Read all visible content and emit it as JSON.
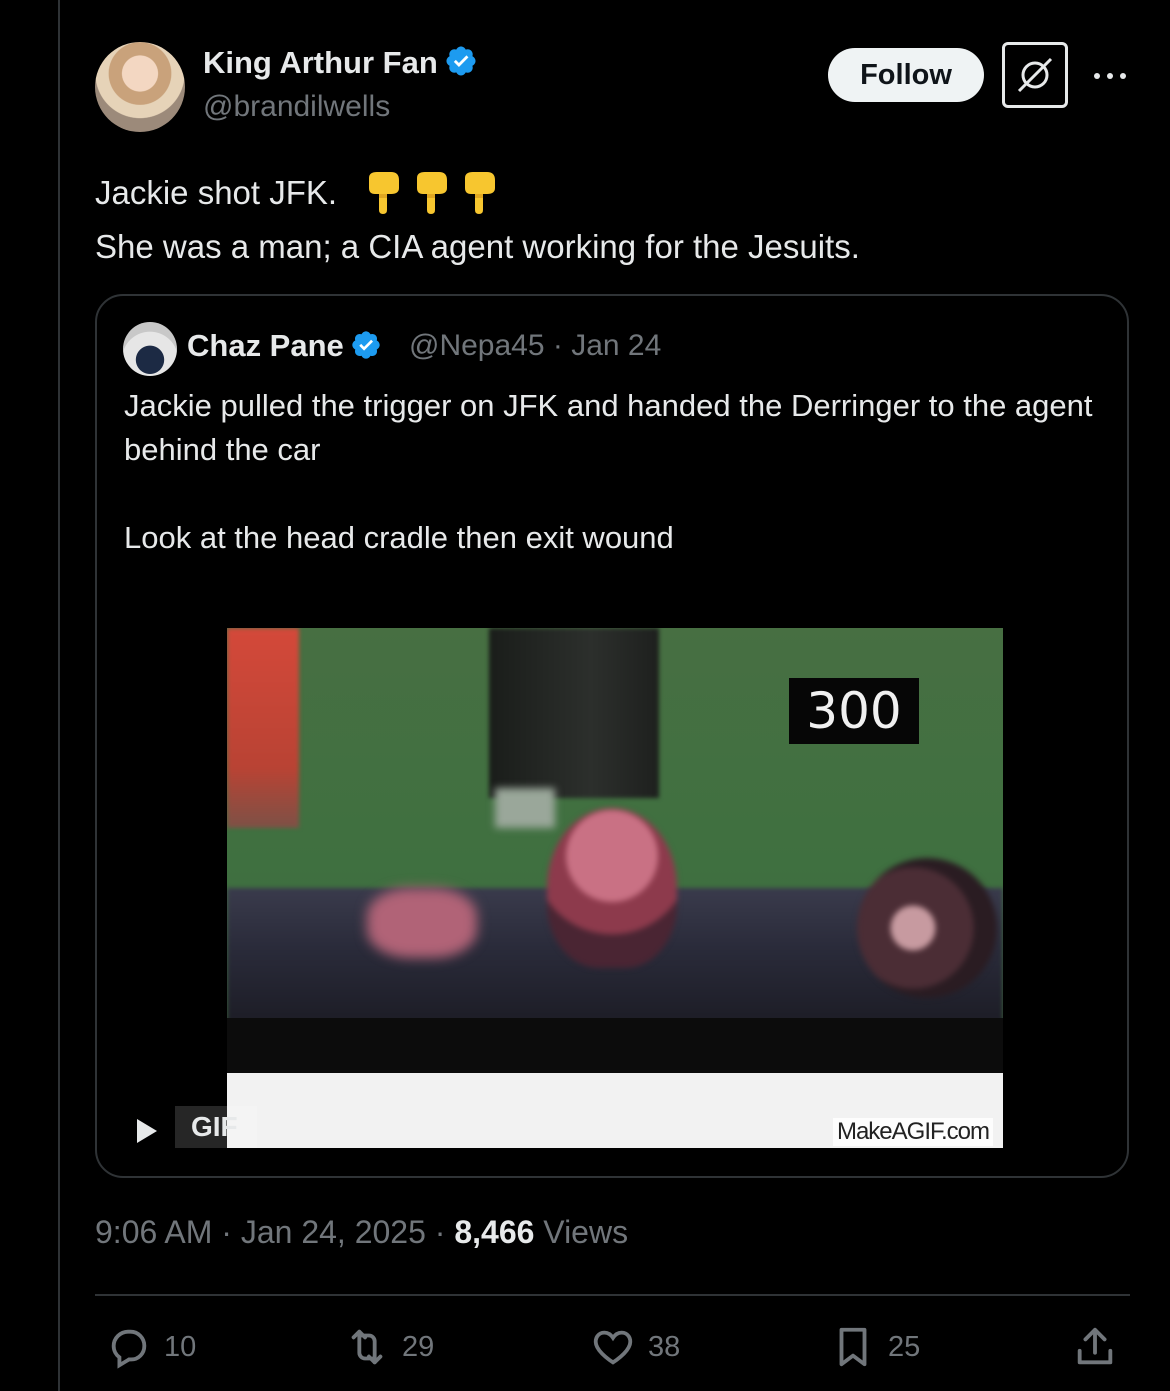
{
  "author": {
    "display_name": "King Arthur Fan",
    "handle": "@brandilwells",
    "verified": true
  },
  "header_buttons": {
    "follow_label": "Follow"
  },
  "tweet": {
    "line1": "Jackie shot JFK.",
    "line1_emoji": [
      "backhand-index-pointing-down",
      "backhand-index-pointing-down",
      "backhand-index-pointing-down"
    ],
    "line2": "She was a man; a CIA agent working for the Jesuits."
  },
  "quote": {
    "display_name": "Chaz Pane",
    "verified": true,
    "meta": "@Nepa45 · Jan 24",
    "paragraph1": "Jackie pulled the trigger on JFK and handed the Derringer to the agent behind the car",
    "paragraph2": "Look at the head cradle then exit wound",
    "media": {
      "counter": "300",
      "watermark": "MakeAGIF.com",
      "badge": "GIF"
    }
  },
  "timestamp": {
    "prefix": "9:06 AM · Jan 24, 2025 · ",
    "views_count": "8,466",
    "views_label": " Views"
  },
  "actions": {
    "replies": "10",
    "reposts": "29",
    "likes": "38",
    "bookmarks": "25"
  },
  "colors": {
    "background": "#000000",
    "text": "#e7e9ea",
    "muted": "#71767b",
    "border": "#2f3336",
    "verified_blue": "#1d9bf0",
    "emoji_yellow": "#f7c62f"
  }
}
